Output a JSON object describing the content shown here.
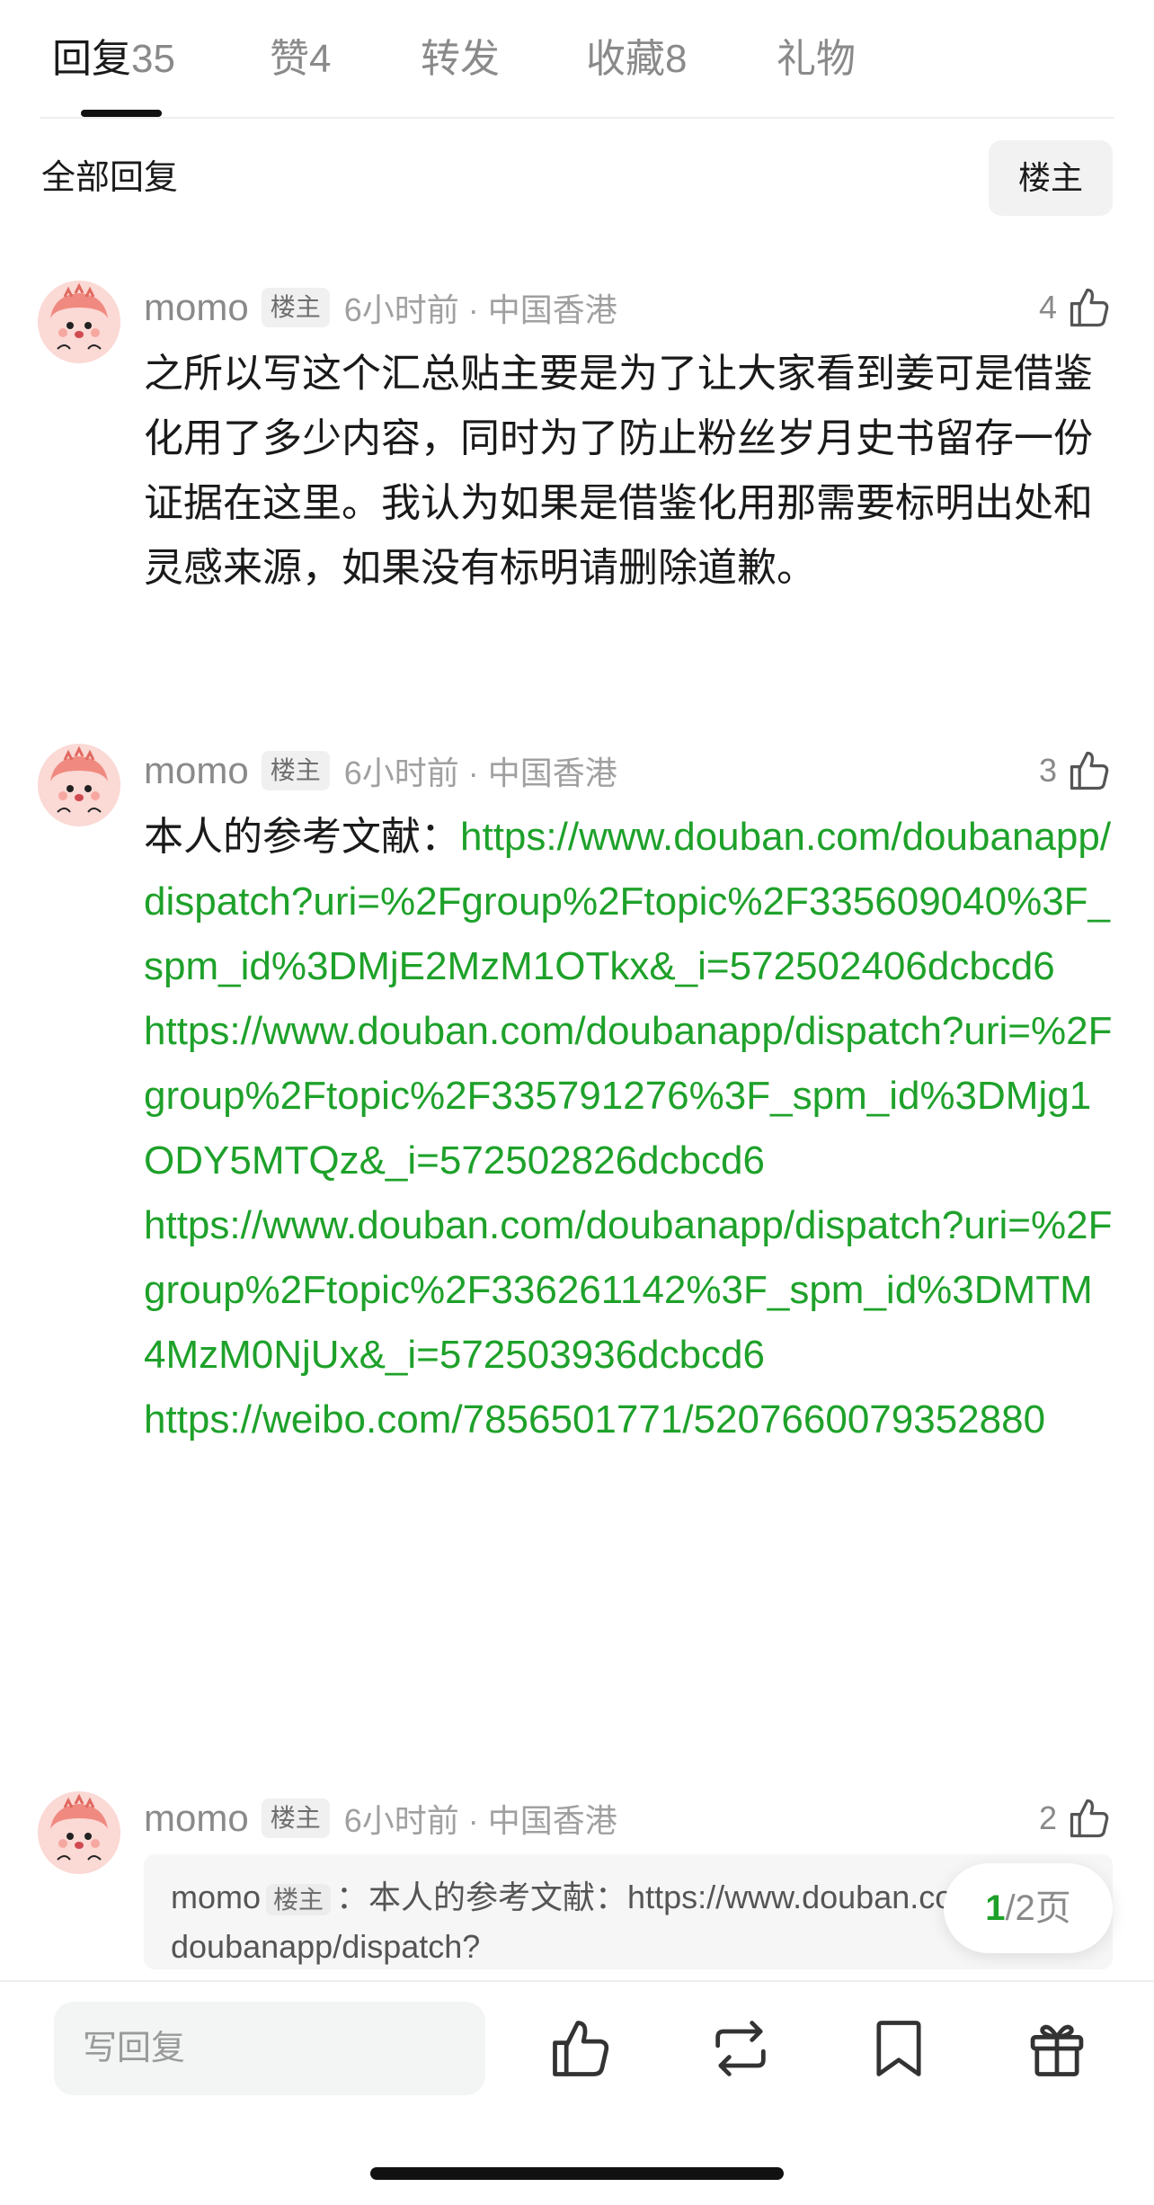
{
  "tabs": [
    {
      "label": "回复",
      "count": "35"
    },
    {
      "label": "赞",
      "count": "4"
    },
    {
      "label": "转发",
      "count": ""
    },
    {
      "label": "收藏",
      "count": "8"
    },
    {
      "label": "礼物",
      "count": ""
    }
  ],
  "filter": {
    "label": "全部回复",
    "op_only_button": "楼主"
  },
  "comments": [
    {
      "username": "momo",
      "badge": "楼主",
      "time_location": "6小时前 · 中国香港",
      "likes": "4",
      "text": "之所以写这个汇总贴主要是为了让大家看到姜可是借鉴化用了多少内容，同时为了防止粉丝岁月史书留存一份证据在这里。我认为如果是借鉴化用那需要标明出处和灵感来源，如果没有标明请删除道歉。"
    },
    {
      "username": "momo",
      "badge": "楼主",
      "time_location": "6小时前 · 中国香港",
      "likes": "3",
      "prefix": "本人的参考文献：",
      "links": [
        "https://www.douban.com/doubanapp/dispatch?uri=%2Fgroup%2Ftopic%2F335609040%3F_spm_id%3DMjE2MzM1OTkx&_i=572502406dcbcd6",
        "https://www.douban.com/doubanapp/dispatch?uri=%2Fgroup%2Ftopic%2F335791276%3F_spm_id%3DMjg1ODY5MTQz&_i=572502826dcbcd6",
        "https://www.douban.com/doubanapp/dispatch?uri=%2Fgroup%2Ftopic%2F336261142%3F_spm_id%3DMTM4MzM0NjUx&_i=572503936dcbcd6",
        "https://weibo.com/7856501771/5207660079352880"
      ]
    },
    {
      "username": "momo",
      "badge": "楼主",
      "time_location": "6小时前 · 中国香港",
      "likes": "2",
      "quote": {
        "author": "momo",
        "badge": "楼主",
        "text_line1": "：本人的参考文献：https://www.douban.com/",
        "text_line2": "doubanapp/dispatch?"
      }
    }
  ],
  "pagination": {
    "current": "1",
    "total_text": "/2页"
  },
  "bottom_bar": {
    "reply_placeholder": "写回复",
    "icons": [
      "thumbs-up-icon",
      "repost-icon",
      "bookmark-icon",
      "gift-icon"
    ]
  },
  "colors": {
    "link": "#1ea12a",
    "accent": "#111111"
  }
}
